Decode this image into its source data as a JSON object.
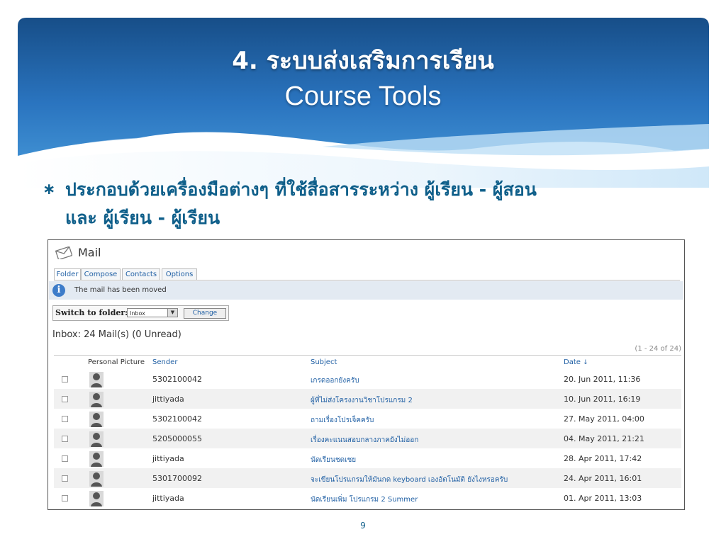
{
  "slide": {
    "title_th": "4. ระบบส่งเสริมการเรียน",
    "title_en": "Course Tools",
    "bullet_symbol": "∗",
    "bullet_line1": "ประกอบด้วยเครื่องมือต่างๆ ที่ใช้สื่อสารระหว่าง ผู้เรียน - ผู้สอน",
    "bullet_line2": "และ ผู้เรียน - ผู้เรียน",
    "page_number": "9",
    "colors": {
      "header_dark": "#174e88",
      "header_light": "#3f8fd2",
      "accent": "#0f5f8a"
    }
  },
  "mail": {
    "title": "Mail",
    "icon": "envelope-icon",
    "tabs": [
      "Folder",
      "Compose",
      "Contacts",
      "Options"
    ],
    "active_tab": "Folder",
    "notice": "The mail has been moved",
    "switch_label": "Switch to folder:",
    "folder_value": "Inbox",
    "change_button": "Change",
    "summary": "Inbox: 24 Mail(s) (0 Unread)",
    "range": "(1 - 24 of 24)",
    "columns": {
      "picture": "Personal Picture",
      "sender": "Sender",
      "subject": "Subject",
      "date": "Date"
    },
    "sort_indicator": "↓",
    "rows": [
      {
        "sender": "5302100042",
        "subject": "เกรดออกยังครับ",
        "date": "20. Jun 2011, 11:36"
      },
      {
        "sender": "jittiyada",
        "subject": "ผู้ที่ไม่ส่งโครงงานวิชาโปรแกรม 2",
        "date": "10. Jun 2011, 16:19"
      },
      {
        "sender": "5302100042",
        "subject": "ถามเรื่องโปรเจ็คครับ",
        "date": "27. May 2011, 04:00"
      },
      {
        "sender": "5205000055",
        "subject": "เรื่องคะแนนสอบกลางภาคยังไม่ออก",
        "date": "04. May 2011, 21:21"
      },
      {
        "sender": "jittiyada",
        "subject": "นัดเรียนชดเชย",
        "date": "28. Apr 2011, 17:42"
      },
      {
        "sender": "5301700092",
        "subject": "จะเขียนโปรแกรมให้มันกด keyboard เองอัตโนมัติ ยังไงหรอครับ",
        "date": "24. Apr 2011, 16:01"
      },
      {
        "sender": "jittiyada",
        "subject": "นัดเรียนเพิ่ม โปรแกรม 2 Summer",
        "date": "01. Apr 2011, 13:03"
      }
    ]
  }
}
